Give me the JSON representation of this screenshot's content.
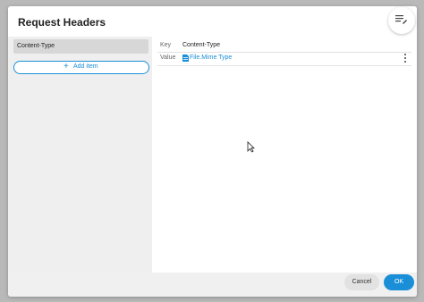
{
  "dialog": {
    "title": "Request Headers"
  },
  "sidebar": {
    "items": [
      {
        "label": "Content-Type"
      }
    ],
    "add_label": "Add item"
  },
  "fields": {
    "key_label": "Key",
    "key_value": "Content-Type",
    "value_label": "Value",
    "value_value": "File.Mime Type"
  },
  "footer": {
    "cancel_label": "Cancel",
    "ok_label": "OK"
  },
  "icons": {
    "header_action": "edit-list-icon",
    "add": "plus-icon",
    "value_type": "file-icon",
    "more": "kebab-menu-icon",
    "cursor": "mouse-cursor-icon"
  },
  "colors": {
    "accent": "#1a8fd8",
    "overlay": "#b9b9b9",
    "sidebar_bg": "#efefef",
    "selected_item_bg": "#d7d7d7"
  }
}
